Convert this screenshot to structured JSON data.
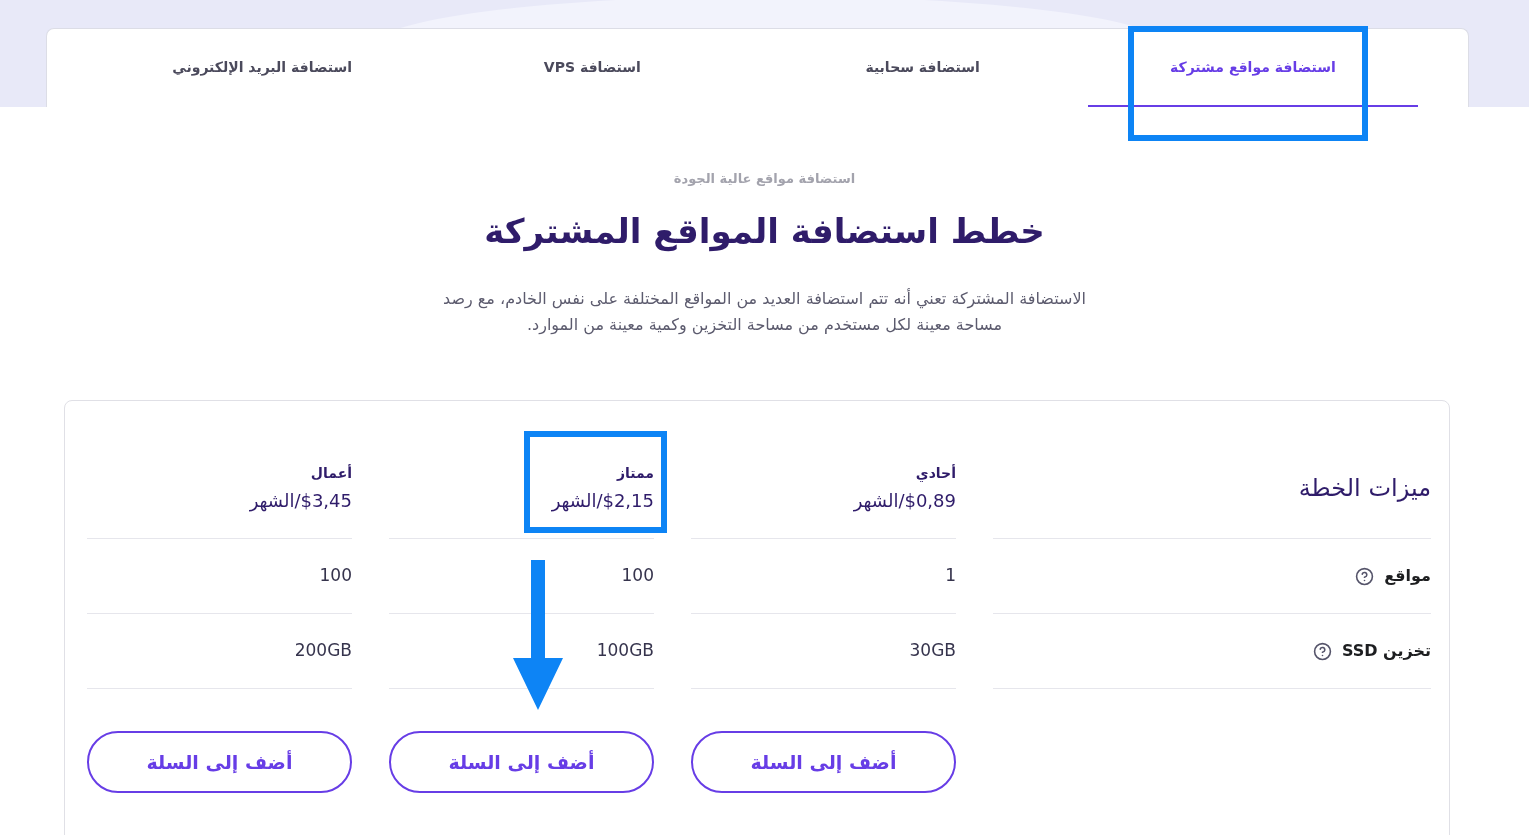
{
  "tabs": [
    {
      "label": "استضافة مواقع مشتركة",
      "selected": true,
      "highlighted": true
    },
    {
      "label": "استضافة سحابية",
      "selected": false,
      "highlighted": false
    },
    {
      "label": "استضافة VPS",
      "selected": false,
      "highlighted": false
    },
    {
      "label": "استضافة البريد الإلكتروني",
      "selected": false,
      "highlighted": false
    }
  ],
  "hero": {
    "eyebrow": "استضافة مواقع عالية الجودة",
    "title": "خطط استضافة المواقع المشتركة",
    "description": "الاستضافة المشتركة تعني أنه تتم استضافة العديد من المواقع المختلفة على نفس الخادم، مع رصد مساحة معينة لكل مستخدم من مساحة التخزين وكمية معينة من الموارد."
  },
  "comparison": {
    "title": "ميزات الخطة",
    "features": [
      {
        "label": "مواقع",
        "help": true
      },
      {
        "label": "تخزين SSD",
        "help": true
      }
    ],
    "plans": [
      {
        "name": "أحادي",
        "price": "$0,89/الشهر",
        "values": [
          "1",
          "30GB"
        ],
        "button": "أضف إلى السلة",
        "highlighted": false,
        "arrow": false
      },
      {
        "name": "ممتاز",
        "price": "$2,15/الشهر",
        "values": [
          "100",
          "100GB"
        ],
        "button": "أضف إلى السلة",
        "highlighted": true,
        "arrow": true
      },
      {
        "name": "أعمال",
        "price": "$3,45/الشهر",
        "values": [
          "100",
          "200GB"
        ],
        "button": "أضف إلى السلة",
        "highlighted": false,
        "arrow": false
      }
    ]
  }
}
